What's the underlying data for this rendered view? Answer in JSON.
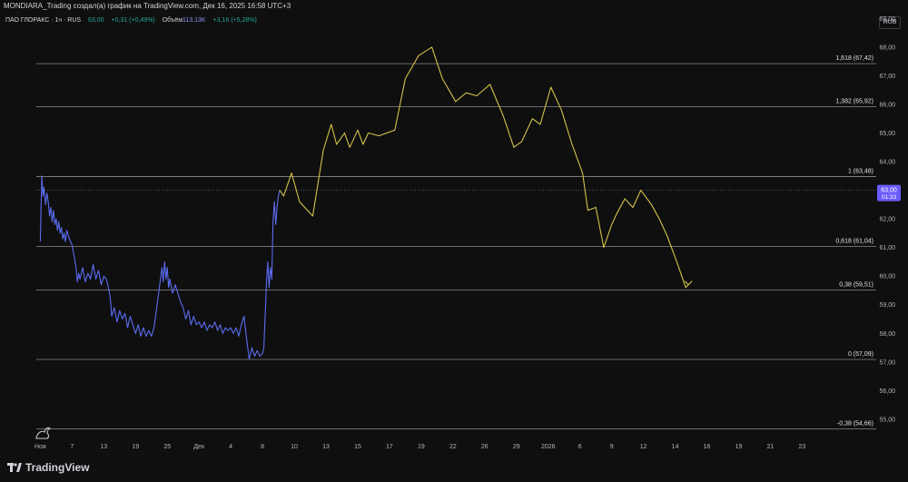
{
  "header": {
    "title": "MONDIARA_Trading создал(а) график на TradingView.com, Дек 16, 2025 16:58 UTC+3"
  },
  "legend": {
    "symbol": "ПАО ГЛОРАКС · 1ч · RUS",
    "price": "63,00",
    "change": "+0,31 (+0,49%)",
    "volume_label": "Объём",
    "volume_value": "113,13K",
    "volume_change": "+3,16 (+5,28%)"
  },
  "currency": "RUB",
  "brand": "TradingView",
  "colors": {
    "background": "#0f0f0f",
    "price_line": "#5b6cf0",
    "forecast_line": "#d4c24a",
    "fib_line": "#8a8a8a",
    "label_bg": "#6a5cff"
  },
  "chart_data": {
    "type": "line",
    "ylim": [
      54.3,
      69.2
    ],
    "y_ticks": [
      "69,00",
      "68,00",
      "67,00",
      "66,00",
      "65,00",
      "64,00",
      "63,00",
      "62,00",
      "61,00",
      "60,00",
      "59,00",
      "58,00",
      "57,00",
      "56,00",
      "55,00"
    ],
    "y_tick_values": [
      69,
      68,
      67,
      66,
      65,
      64,
      63,
      62,
      61,
      60,
      59,
      58,
      57,
      56,
      55
    ],
    "x_ticks": [
      "Ноя",
      "7",
      "13",
      "19",
      "25",
      "Дек",
      "4",
      "8",
      "10",
      "13",
      "15",
      "17",
      "19",
      "22",
      "26",
      "29",
      "2026",
      "6",
      "9",
      "12",
      "14",
      "16",
      "19",
      "21",
      "23"
    ],
    "x_tick_index": [
      0,
      12,
      24,
      36,
      48,
      60,
      72,
      84,
      96,
      108,
      120,
      132,
      144,
      156,
      168,
      180,
      192,
      204,
      216,
      228,
      240,
      252,
      264,
      276,
      288
    ],
    "x_range": [
      -1.5,
      316
    ],
    "last_price": "63,00",
    "countdown": "01:33",
    "fib_levels": [
      {
        "label": "1,618 (67,42)",
        "value": 67.42
      },
      {
        "label": "1,382 (65,92)",
        "value": 65.92
      },
      {
        "label": "1 (63,48)",
        "value": 63.48
      },
      {
        "label": "0,618 (61,04)",
        "value": 61.04
      },
      {
        "label": "0,38 (59,51)",
        "value": 59.51
      },
      {
        "label": "0 (57,09)",
        "value": 57.09
      },
      {
        "label": "-0,38 (54,66)",
        "value": 54.66
      }
    ],
    "series": [
      {
        "kind": "price",
        "points": [
          [
            0,
            61.2
          ],
          [
            0.3,
            62.4
          ],
          [
            0.6,
            63.5
          ],
          [
            1,
            62.8
          ],
          [
            1.4,
            63.1
          ],
          [
            2,
            62.5
          ],
          [
            2.5,
            62.9
          ],
          [
            3,
            62.6
          ],
          [
            3.5,
            62.1
          ],
          [
            4,
            62.4
          ],
          [
            4.5,
            61.9
          ],
          [
            5,
            62.3
          ],
          [
            5.5,
            61.8
          ],
          [
            6,
            62.0
          ],
          [
            6.5,
            61.6
          ],
          [
            7,
            61.9
          ],
          [
            7.5,
            61.5
          ],
          [
            8,
            61.7
          ],
          [
            8.5,
            61.3
          ],
          [
            9,
            61.5
          ],
          [
            9.5,
            61.2
          ],
          [
            10,
            61.6
          ],
          [
            11,
            61.3
          ],
          [
            12,
            61.1
          ],
          [
            13,
            60.6
          ],
          [
            13.5,
            60.3
          ],
          [
            14,
            59.8
          ],
          [
            14.5,
            60.1
          ],
          [
            15,
            59.9
          ],
          [
            16,
            60.3
          ],
          [
            17,
            59.8
          ],
          [
            18,
            60.1
          ],
          [
            19,
            59.9
          ],
          [
            20,
            60.4
          ],
          [
            21,
            59.9
          ],
          [
            22,
            60.2
          ],
          [
            23,
            59.7
          ],
          [
            24,
            60.0
          ],
          [
            25,
            59.9
          ],
          [
            26,
            59.5
          ],
          [
            26.5,
            59.2
          ],
          [
            27,
            58.6
          ],
          [
            28,
            58.9
          ],
          [
            29,
            58.4
          ],
          [
            30,
            58.8
          ],
          [
            31,
            58.5
          ],
          [
            32,
            58.7
          ],
          [
            33,
            58.2
          ],
          [
            34,
            58.6
          ],
          [
            35,
            58.3
          ],
          [
            36,
            58.0
          ],
          [
            37,
            58.3
          ],
          [
            38,
            57.9
          ],
          [
            39,
            58.2
          ],
          [
            40,
            57.9
          ],
          [
            41,
            58.1
          ],
          [
            42,
            57.9
          ],
          [
            43,
            58.2
          ],
          [
            44,
            58.9
          ],
          [
            45,
            59.6
          ],
          [
            46,
            60.3
          ],
          [
            46.5,
            59.8
          ],
          [
            47,
            60.5
          ],
          [
            47.5,
            59.9
          ],
          [
            48,
            60.3
          ],
          [
            48.5,
            59.6
          ],
          [
            49,
            59.9
          ],
          [
            50,
            59.4
          ],
          [
            51,
            59.7
          ],
          [
            52,
            59.4
          ],
          [
            53,
            59.1
          ],
          [
            54,
            58.9
          ],
          [
            55,
            58.5
          ],
          [
            56,
            58.8
          ],
          [
            57,
            58.3
          ],
          [
            58,
            58.6
          ],
          [
            59,
            58.3
          ],
          [
            60,
            58.4
          ],
          [
            61,
            58.2
          ],
          [
            62,
            58.4
          ],
          [
            63,
            58.1
          ],
          [
            64,
            58.3
          ],
          [
            65,
            58.2
          ],
          [
            66,
            58.4
          ],
          [
            67,
            58.1
          ],
          [
            68,
            58.3
          ],
          [
            69,
            58.0
          ],
          [
            70,
            58.2
          ],
          [
            71,
            58.1
          ],
          [
            72,
            58.2
          ],
          [
            73,
            58.0
          ],
          [
            74,
            58.2
          ],
          [
            75,
            57.9
          ],
          [
            76,
            58.3
          ],
          [
            77,
            58.6
          ],
          [
            78,
            57.8
          ],
          [
            79,
            57.1
          ],
          [
            80,
            57.5
          ],
          [
            81,
            57.2
          ],
          [
            82,
            57.4
          ],
          [
            83,
            57.2
          ],
          [
            84,
            57.3
          ],
          [
            84.5,
            57.5
          ],
          [
            85,
            58.6
          ],
          [
            85.5,
            59.8
          ],
          [
            86,
            60.5
          ],
          [
            86.5,
            59.6
          ],
          [
            87,
            60.3
          ],
          [
            87.5,
            59.9
          ],
          [
            88,
            61.9
          ],
          [
            88.5,
            62.6
          ],
          [
            89,
            61.8
          ],
          [
            89.5,
            62.4
          ],
          [
            90,
            62.8
          ],
          [
            90.5,
            63.0
          ]
        ]
      },
      {
        "kind": "forecast",
        "points": [
          [
            90.5,
            63.0
          ],
          [
            92,
            62.8
          ],
          [
            95,
            63.6
          ],
          [
            98,
            62.6
          ],
          [
            103,
            62.1
          ],
          [
            107,
            64.4
          ],
          [
            110,
            65.3
          ],
          [
            112,
            64.6
          ],
          [
            115,
            65.0
          ],
          [
            117,
            64.5
          ],
          [
            120,
            65.1
          ],
          [
            122,
            64.6
          ],
          [
            124,
            65.0
          ],
          [
            128,
            64.9
          ],
          [
            134,
            65.1
          ],
          [
            138,
            66.9
          ],
          [
            143,
            67.7
          ],
          [
            148,
            68.0
          ],
          [
            152,
            66.9
          ],
          [
            157,
            66.1
          ],
          [
            161,
            66.4
          ],
          [
            165,
            66.3
          ],
          [
            170,
            66.7
          ],
          [
            175,
            65.6
          ],
          [
            179,
            64.5
          ],
          [
            182,
            64.7
          ],
          [
            186,
            65.5
          ],
          [
            189,
            65.3
          ],
          [
            193,
            66.6
          ],
          [
            197,
            65.8
          ],
          [
            201,
            64.6
          ],
          [
            205,
            63.6
          ],
          [
            207,
            62.3
          ],
          [
            210,
            62.4
          ],
          [
            213,
            61.0
          ],
          [
            216,
            61.8
          ],
          [
            218,
            62.2
          ],
          [
            221,
            62.7
          ],
          [
            224,
            62.4
          ],
          [
            227,
            63.0
          ],
          [
            231,
            62.5
          ],
          [
            234,
            62.0
          ],
          [
            237,
            61.4
          ],
          [
            241,
            60.4
          ],
          [
            244,
            59.6
          ],
          [
            245,
            59.7
          ]
        ]
      }
    ]
  }
}
